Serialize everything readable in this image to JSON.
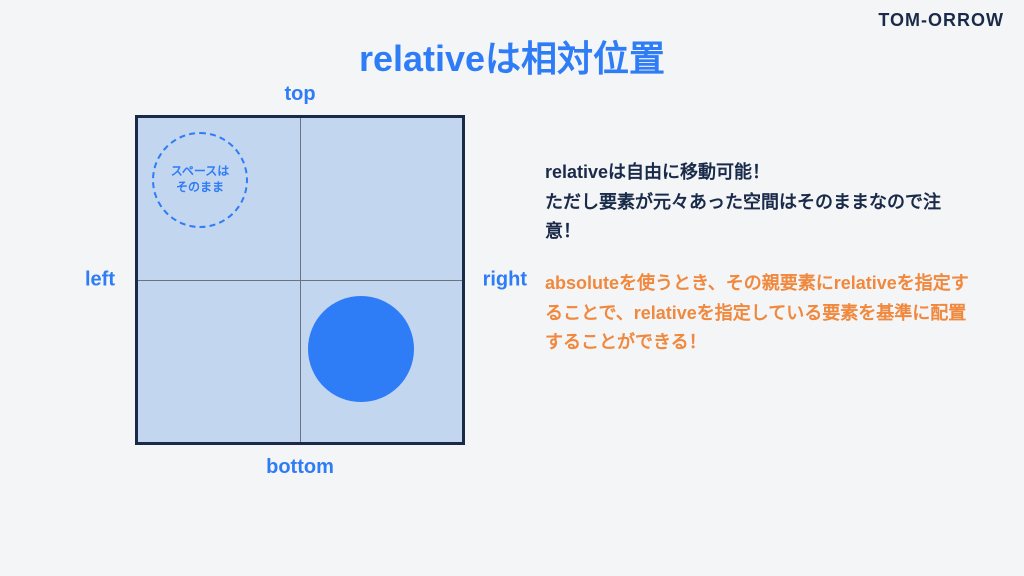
{
  "brand": "TOM-ORROW",
  "title": "relativeは相対位置",
  "diagram": {
    "labels": {
      "top": "top",
      "bottom": "bottom",
      "left": "left",
      "right": "right"
    },
    "dashed_circle_text": "スペースは\nそのまま"
  },
  "explanation": {
    "primary": "relativeは自由に移動可能！\nただし要素が元々あった空間はそのままなので注意！",
    "secondary": "absoluteを使うとき、その親要素にrelativeを指定することで、relativeを指定している要素を基準に配置することができる！"
  }
}
